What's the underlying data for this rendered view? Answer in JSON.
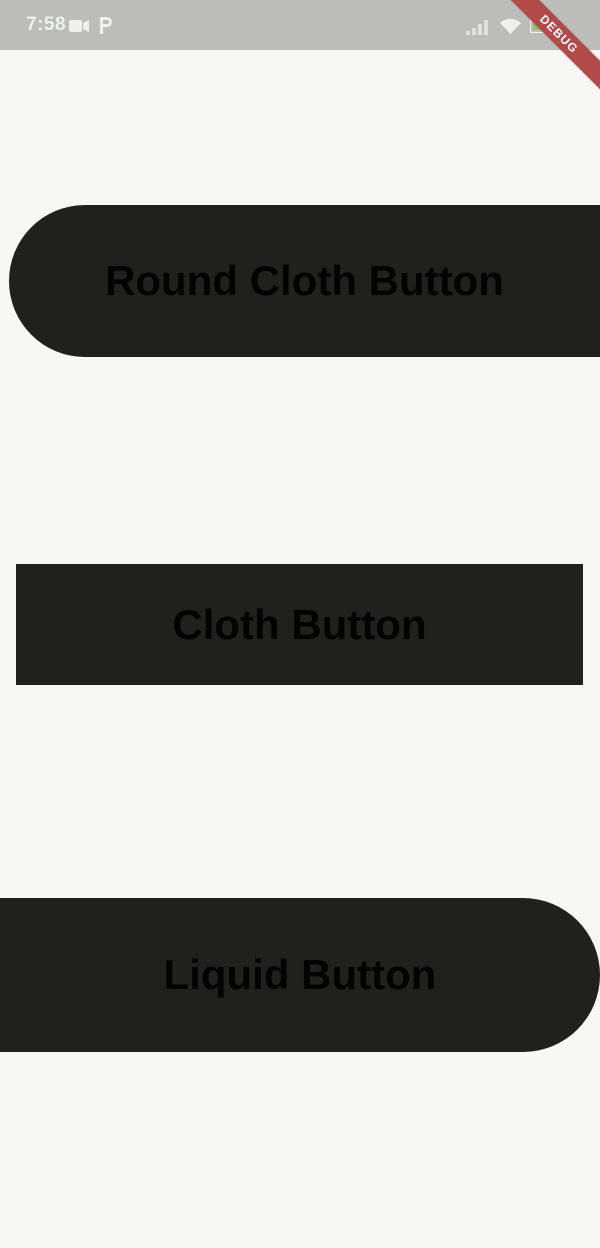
{
  "status_bar": {
    "time": "7:58",
    "icons": [
      "video-camera-icon",
      "parking-icon",
      "signal-icon",
      "wifi-icon",
      "battery-icon"
    ],
    "background": "#bcbdbb"
  },
  "debug_banner": {
    "label": "DEBUG",
    "color": "#b24a4a"
  },
  "buttons": [
    {
      "label": "Round Cloth Button",
      "shape": "rounded",
      "color": "#20211f"
    },
    {
      "label": "Cloth Button",
      "shape": "rectangle",
      "color": "#20211f"
    },
    {
      "label": "Liquid Button",
      "shape": "rounded",
      "color": "#20211f"
    }
  ],
  "page": {
    "background": "#f7f8f6"
  }
}
